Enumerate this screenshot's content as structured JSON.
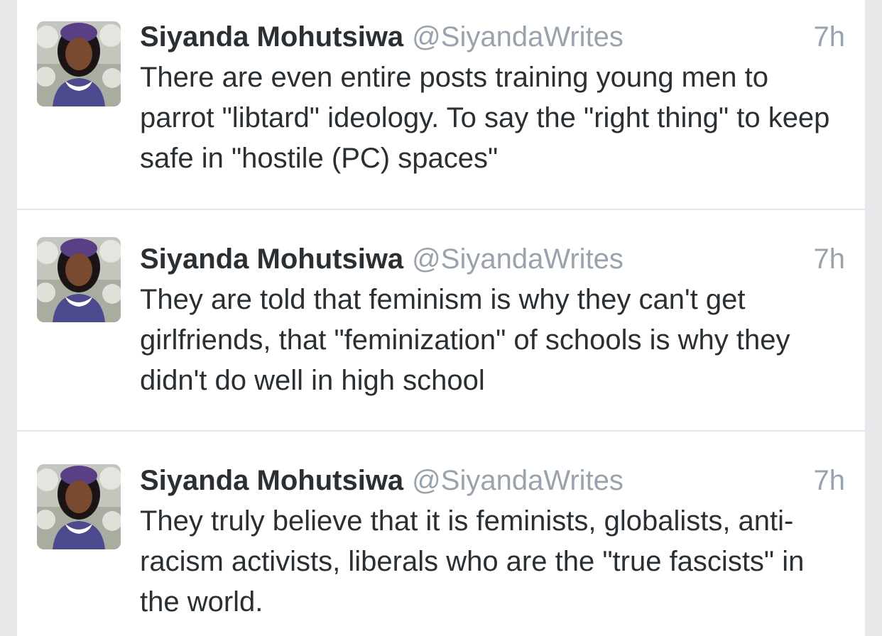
{
  "tweets": [
    {
      "display_name": "Siyanda Mohutsiwa",
      "handle": "@SiyandaWrites",
      "time": "7h",
      "text": "There are even entire posts training young men to parrot \"libtard\" ideology. To say the \"right thing\" to keep safe in \"hostile (PC) spaces\""
    },
    {
      "display_name": "Siyanda Mohutsiwa",
      "handle": "@SiyandaWrites",
      "time": "7h",
      "text": "They are told that feminism is why they can't get girlfriends, that \"feminization\" of schools is why they didn't do well in high school"
    },
    {
      "display_name": "Siyanda Mohutsiwa",
      "handle": "@SiyandaWrites",
      "time": "7h",
      "text": "They truly believe that it is feminists, globalists, anti-racism activists, liberals who are the \"true fascists\" in the world."
    }
  ],
  "colors": {
    "name": "#292f33",
    "secondary": "#99a3ad",
    "divider": "#e1e8ed",
    "background": "#ffffff"
  }
}
